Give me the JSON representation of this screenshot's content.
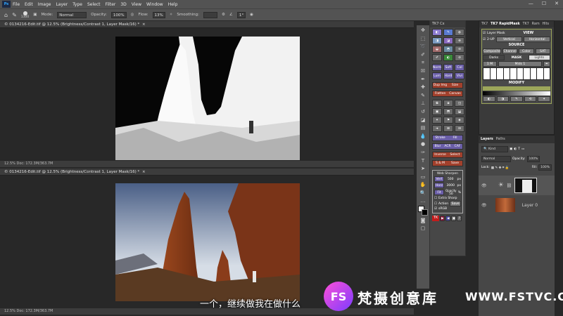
{
  "menubar": {
    "logo": "Ps",
    "items": [
      "File",
      "Edit",
      "Image",
      "Layer",
      "Type",
      "Select",
      "Filter",
      "3D",
      "View",
      "Window",
      "Help"
    ],
    "win_min": "—",
    "win_max": "☐",
    "win_close": "✕"
  },
  "options": {
    "brush_size": "1300",
    "mode_label": "Mode:",
    "mode": "Normal",
    "opacity_label": "Opacity:",
    "opacity": "100%",
    "flow_label": "Flow:",
    "flow": "13%",
    "smoothing_label": "Smoothing:",
    "angle": "1°"
  },
  "doc1": {
    "tab": "© 0134216-Edit.tif @ 12.5% (Brightness/Contrast 1, Layer Mask/16) *",
    "close": "×",
    "status": "12.5%     Doc: 172.3M/363.7M"
  },
  "doc2": {
    "tab": "© 0134216-Edit.tif @ 12.5% (Brightness/Contrast 1, Layer Mask/16) *",
    "close": "×",
    "status": "12.5%     Doc: 172.3M/363.7M"
  },
  "tk7": {
    "title": "TK7 Cx",
    "row_labels": [
      [
        "Norm",
        "Soft",
        "Col"
      ],
      [
        "Lum",
        "Hard",
        "Vivi"
      ],
      [
        "Dup Img",
        "Size"
      ],
      [
        "Flatten",
        "Canvas"
      ],
      [
        "Stroke",
        "Fill"
      ],
      [
        "Blur",
        "ACR",
        "CAF"
      ],
      [
        "Inverse",
        "Select"
      ],
      [
        "S & M",
        "Save"
      ]
    ],
    "sharpen": {
      "title": "Web Sharpen",
      "vert_label": "Vert",
      "vert": "500",
      "horz_label": "Horz",
      "horz": "3000",
      "unit": "px",
      "fit_label": "Fit",
      "opacity_label": "Opacity",
      "opacity": "50",
      "pct": "%",
      "extra": "Extra Sharp",
      "action": "Action",
      "srgb": "sRGB",
      "save": "Save"
    },
    "footer": "TK"
  },
  "rapidmask": {
    "tabs": [
      "TK7",
      "TK7 RapidMask",
      "TK7",
      "Ram",
      "Hlts"
    ],
    "layer_mask": "Layer Mask",
    "view": "VIEW",
    "two_up": "2-UP",
    "vertical": "Vertical",
    "horizontal": "Horizontal",
    "source": "SOURCE",
    "composite": "Composite",
    "channel": "Channel",
    "color": "Color",
    "sat": "SAT",
    "darks": "Darks",
    "mask": "MASK",
    "lights": "Lights",
    "one_m": "1 M",
    "mids": "Mids 1",
    "modify": "MODIFY"
  },
  "layers": {
    "tabs": [
      "Layers",
      "Paths"
    ],
    "kind": "Kind",
    "blend": "Normal",
    "opacity_label": "Opacity:",
    "opacity": "100%",
    "lock_label": "Lock:",
    "fill_label": "Fill:",
    "fill": "100%",
    "layer_name": "Layer 0"
  },
  "subtitle": "一个，继续做我在做什么",
  "watermark": {
    "logo": "FS",
    "brand": "梵摄创意库",
    "url": "WWW.FSTVC.CC"
  },
  "colors": {
    "accent": "#9ca65a",
    "rapidmask_label": "#b59a3c",
    "purple": "#6a5ea8",
    "watermark": "#d9b8ff"
  }
}
